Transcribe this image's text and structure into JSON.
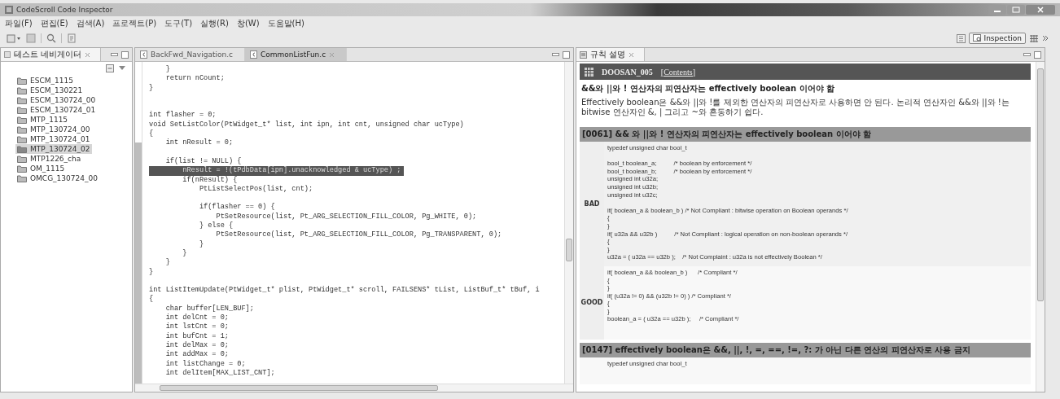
{
  "window": {
    "title": "CodeScroll Code Inspector"
  },
  "menu": [
    "파일(F)",
    "편집(E)",
    "검색(A)",
    "프로젝트(P)",
    "도구(T)",
    "실행(R)",
    "창(W)",
    "도움말(H)"
  ],
  "toolbar": {
    "perspective": "Inspection"
  },
  "navigator": {
    "title": "테스트 네비게이터",
    "items": [
      {
        "label": "ESCM_1115",
        "selected": false
      },
      {
        "label": "ESCM_130221",
        "selected": false
      },
      {
        "label": "ESCM_130724_00",
        "selected": false
      },
      {
        "label": "ESCM_130724_01",
        "selected": false
      },
      {
        "label": "MTP_1115",
        "selected": false
      },
      {
        "label": "MTP_130724_00",
        "selected": false
      },
      {
        "label": "MTP_130724_01",
        "selected": false
      },
      {
        "label": "MTP_130724_02",
        "selected": true
      },
      {
        "label": "MTP1226_cha",
        "selected": false
      },
      {
        "label": "OM_1115",
        "selected": false
      },
      {
        "label": "OMCG_130724_00",
        "selected": false
      }
    ]
  },
  "editor": {
    "tabs": [
      {
        "label": "BackFwd_Navigation.c",
        "selected": false
      },
      {
        "label": "CommonListFun.c",
        "selected": true
      }
    ],
    "lines": [
      {
        "text": "    }",
        "selected": false
      },
      {
        "text": "    return nCount;",
        "selected": false
      },
      {
        "text": "}",
        "selected": false
      },
      {
        "selected": false
      },
      {
        "selected": false
      },
      {
        "text": "int flasher = 0;",
        "selected": false
      },
      {
        "text": "void SetListColor(PtWidget_t* list, int ipn, int cnt, unsigned char ucType)",
        "selected": false
      },
      {
        "text": "{",
        "selected": false
      },
      {
        "text": "    int nResult = 0;",
        "selected": false
      },
      {
        "selected": false
      },
      {
        "text": "    if(list != NULL) {",
        "selected": false
      },
      {
        "text": "        nResult = !(tPdbData[ipn].unacknowledged & ucType) ;",
        "selected": true
      },
      {
        "text": "        if(nResult) {",
        "selected": false
      },
      {
        "text": "            PtListSelectPos(list, cnt);",
        "selected": false
      },
      {
        "selected": false
      },
      {
        "text": "            if(flasher == 0) {",
        "selected": false
      },
      {
        "text": "                PtSetResource(list, Pt_ARG_SELECTION_FILL_COLOR, Pg_WHITE, 0);",
        "selected": false
      },
      {
        "text": "            } else {",
        "selected": false
      },
      {
        "text": "                PtSetResource(list, Pt_ARG_SELECTION_FILL_COLOR, Pg_TRANSPARENT, 0);",
        "selected": false
      },
      {
        "text": "            }",
        "selected": false
      },
      {
        "text": "        }",
        "selected": false
      },
      {
        "text": "    }",
        "selected": false
      },
      {
        "text": "}",
        "selected": false
      },
      {
        "selected": false
      },
      {
        "text": "int ListItemUpdate(PtWidget_t* plist, PtWidget_t* scroll, FAILSENS* tList, ListBuf_t* tBuf, i",
        "selected": false
      },
      {
        "text": "{",
        "selected": false
      },
      {
        "text": "    char buffer[LEN_BUF];",
        "selected": false
      },
      {
        "text": "    int delCnt = 0;",
        "selected": false
      },
      {
        "text": "    int lstCnt = 0;",
        "selected": false
      },
      {
        "text": "    int bufCnt = 1;",
        "selected": false
      },
      {
        "text": "    int delMax = 0;",
        "selected": false
      },
      {
        "text": "    int addMax = 0;",
        "selected": false
      },
      {
        "text": "    int listChange = 0;",
        "selected": false
      },
      {
        "text": "    int delItem[MAX_LIST_CNT];",
        "selected": false
      }
    ]
  },
  "rule_panel": {
    "title": "규칙 설명",
    "rule_id": "DOOSAN_005",
    "contents_link": "[Contents]",
    "heading": "&&와 ||와 ! 연산자의 피연산자는 effectively boolean 이어야 함",
    "description": "Effectively boolean은 &&와 ||와 !를 제외한 연산자의 피연산자로 사용하면 안 된다. 논리적 연산자인 &&와 ||와 !는 bitwise 연산자인 &, | 그리고 ~와 혼동하기 쉽다.",
    "sections": [
      {
        "header": "[0061] && 와 ||와 ! 연산자의 피연산자는 effectively boolean 이어야 함",
        "examples": [
          {
            "label": "BAD",
            "blocks": [
              [
                "typedef unsigned char bool_t"
              ],
              [
                "bool_t boolean_a;          /* boolean by enforcement */",
                "bool_t boolean_b;          /* boolean by enforcement */",
                "unsigned int u32a;",
                "unsigned int u32b;",
                "unsigned int u32c;"
              ],
              [
                "if( boolean_a & boolean_b ) /* Not Compliant : bitwise operation on Boolean operands */",
                "{",
                "}",
                "if( u32a && u32b )          /* Not Compliant : logical operation on non-boolean operands */",
                "{",
                "}",
                "u32a = ( u32a == u32b );    /* Not Complaint : u32a is not effectively Boolean */"
              ]
            ]
          },
          {
            "label": "GOOD",
            "blocks": [
              [
                "if( boolean_a && boolean_b )      /* Compliant */",
                "{",
                "}",
                "if( (u32a != 0) && (u32b != 0) ) /* Compliant */",
                "{",
                "}",
                "boolean_a = ( u32a == u32b );     /* Compliant */"
              ]
            ]
          }
        ]
      },
      {
        "header": "[0147] effectively boolean은 &&, ||, !, =, ==, !=, ?: 가 아닌 다른 연산의 피연산자로 사용 금지",
        "examples": [
          {
            "blocks": [
              [
                "typedef unsigned char bool_t"
              ]
            ]
          }
        ]
      }
    ]
  }
}
